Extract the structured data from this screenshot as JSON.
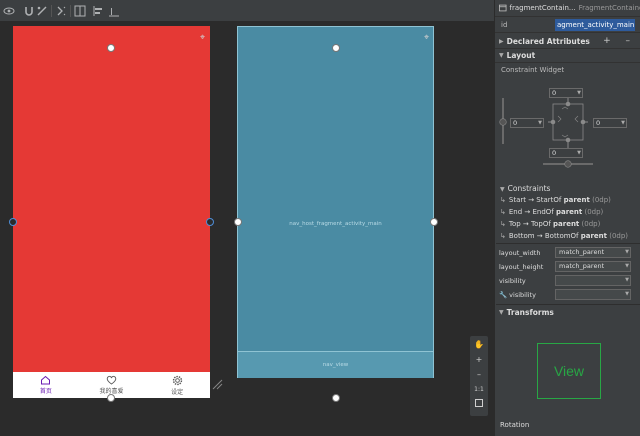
{
  "toolbar": {
    "icons": [
      "eye-icon",
      "magnet-icon",
      "infer-constraints-icon",
      "clear-constraints-icon",
      "margin-icon",
      "align-icon",
      "baseline-icon"
    ]
  },
  "canvas": {
    "red_screen": {
      "color": "#e53935",
      "bottom_nav": [
        {
          "label": "首页",
          "icon": "home-icon",
          "active": true
        },
        {
          "label": "我的喜爱",
          "icon": "heart-icon",
          "active": false
        },
        {
          "label": "设定",
          "icon": "gear-icon",
          "active": false
        }
      ]
    },
    "blue_screen": {
      "color": "#4a8ba3",
      "fragment_label": "nav_host_fragment_activity_main",
      "nav_label": "nav_view"
    },
    "zoom": {
      "hand": "✋",
      "plus": "+",
      "minus": "–",
      "one_to_one": "1:1"
    }
  },
  "attributes": {
    "header": {
      "component": "fragmentContain...",
      "class": "FragmentContainer..."
    },
    "id_label": "id",
    "id_value": "agment_activity_main",
    "declared_attributes": "Declared Attributes",
    "layout": "Layout",
    "constraint_widget": "Constraint Widget",
    "margins": {
      "top": "0",
      "left": "0",
      "right": "0",
      "bottom": "0"
    },
    "constraints_title": "Constraints",
    "constraints": [
      {
        "pre": "Start → StartOf ",
        "bold": "parent",
        "post": " (0dp)"
      },
      {
        "pre": "End → EndOf ",
        "bold": "parent",
        "post": " (0dp)"
      },
      {
        "pre": "Top → TopOf ",
        "bold": "parent",
        "post": " (0dp)"
      },
      {
        "pre": "Bottom → BottomOf ",
        "bold": "parent",
        "post": " (0dp)"
      }
    ],
    "layout_width_label": "layout_width",
    "layout_width_value": "match_parent",
    "layout_height_label": "layout_height",
    "layout_height_value": "match_parent",
    "visibility_label": "visibility",
    "visibility_value": "",
    "tools_visibility_label": "visibility",
    "tools_visibility_value": "",
    "transforms": "Transforms",
    "view_preview": "View",
    "rotation": "Rotation",
    "accent_green": "#28a745",
    "selection_blue": "#2e5b9c"
  }
}
